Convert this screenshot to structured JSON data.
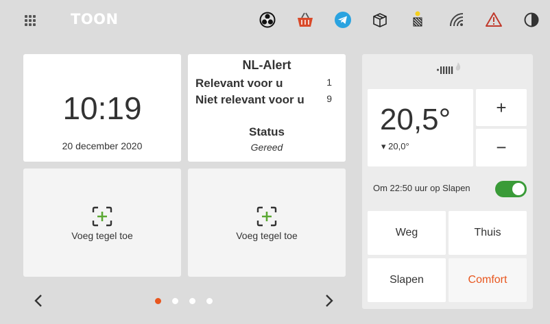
{
  "header": {
    "logo": "TOON",
    "icons": [
      "apps-grid-icon",
      "fan-icon",
      "shopping-basket-icon",
      "telegram-icon",
      "package-icon",
      "solar-panel-icon",
      "wifi-icon",
      "warning-icon",
      "contrast-icon"
    ]
  },
  "clock": {
    "time": "10:19",
    "date": "20 december 2020"
  },
  "nl_alert": {
    "title": "NL-Alert",
    "rows": [
      {
        "label": "Relevant voor u",
        "count": "1"
      },
      {
        "label": "Niet relevant voor u",
        "count": "9"
      }
    ],
    "status_label": "Status",
    "status_value": "Gereed"
  },
  "add_tiles": [
    {
      "label": "Voeg tegel toe"
    },
    {
      "label": "Voeg tegel toe"
    }
  ],
  "pagination": {
    "pages": 4,
    "active": 0
  },
  "thermostat": {
    "current_temp": "20,5°",
    "setpoint": "▾ 20,0°",
    "plus_label": "+",
    "minus_label": "−",
    "schedule_text": "Om 22:50 uur op Slapen",
    "schedule_enabled": true,
    "modes": [
      {
        "label": "Weg"
      },
      {
        "label": "Thuis"
      },
      {
        "label": "Slapen"
      },
      {
        "label": "Comfort"
      }
    ],
    "active_mode": "Comfort"
  },
  "colors": {
    "background": "#dcdcdc",
    "accent": "#e8561e",
    "toggle_on": "#3a9b38",
    "add_icon_green": "#5aa832",
    "basket_red": "#d94a2a",
    "telegram_blue": "#2aa3e0",
    "warning_red": "#c0392b"
  }
}
